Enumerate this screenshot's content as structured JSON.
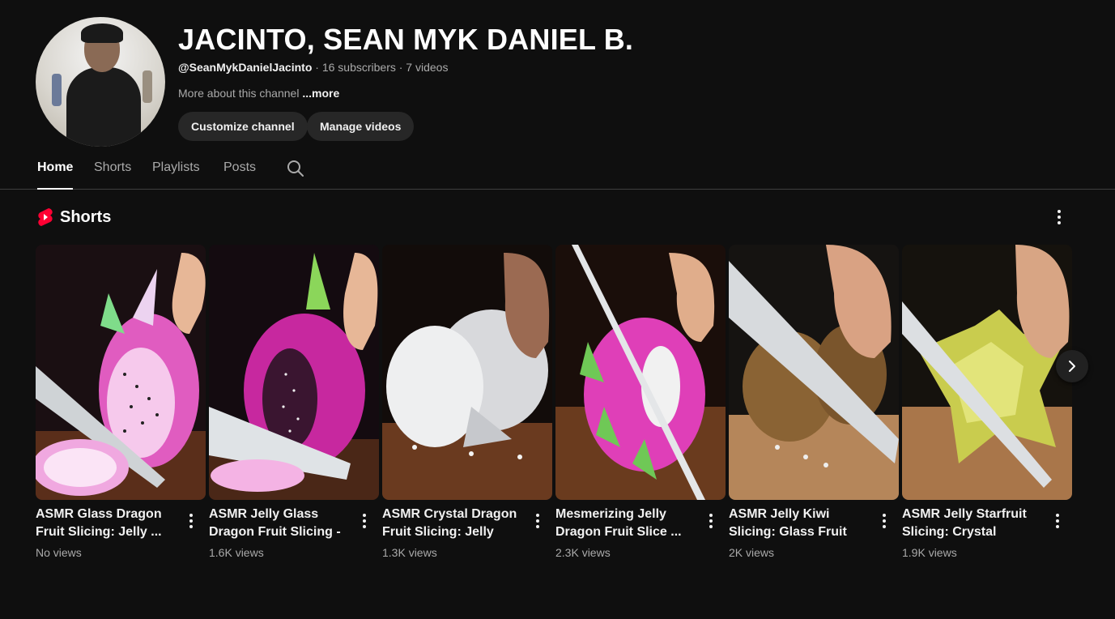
{
  "channel": {
    "name": "JACINTO, SEAN MYK DANIEL B.",
    "handle": "@SeanMykDanielJacinto",
    "stats": " · 16 subscribers · 7 videos",
    "about": "More about this channel ",
    "more": "...more",
    "customize_label": "Customize channel",
    "manage_label": "Manage videos"
  },
  "tabs": [
    {
      "label": "Home",
      "active": true
    },
    {
      "label": "Shorts"
    },
    {
      "label": "Playlists"
    },
    {
      "label": "Posts"
    }
  ],
  "section": {
    "title": "Shorts",
    "icon": "shorts-icon"
  },
  "shorts": [
    {
      "title": "ASMR Glass Dragon Fruit Slicing: Jelly ...",
      "views": "No views"
    },
    {
      "title": "ASMR Jelly Glass Dragon Fruit Slicing - ...",
      "views": "1.6K views"
    },
    {
      "title": "ASMR Crystal Dragon Fruit Slicing: Jelly Glas...",
      "views": "1.3K views"
    },
    {
      "title": "Mesmerizing Jelly Dragon Fruit Slice ...",
      "views": "2.3K views"
    },
    {
      "title": "ASMR Jelly Kiwi Slicing: Glass Fruit Perfection!",
      "views": "2K views"
    },
    {
      "title": "ASMR Jelly Starfruit Slicing: Crystal Crunch...",
      "views": "1.9K views"
    }
  ],
  "colors": {
    "background": "#0f0f0f",
    "chip": "#272727",
    "shorts_red": "#ff0033"
  }
}
